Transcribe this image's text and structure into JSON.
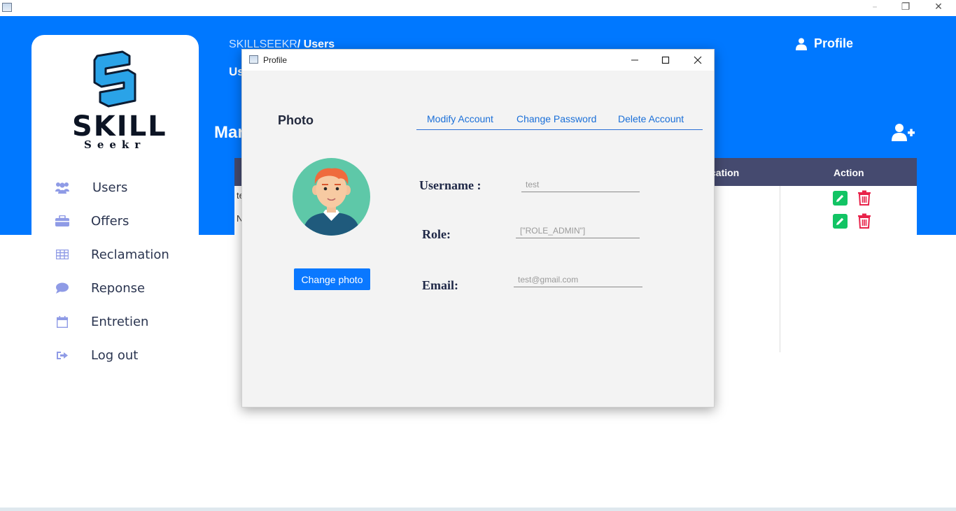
{
  "app": {
    "breadcrumb_root": "SKILLSEEKR",
    "breadcrumb_current": "/ Users",
    "subtitle_partial": "Us",
    "heading_partial": "Mar",
    "profile_label": "Profile",
    "logo_word": "SKILL",
    "logo_sub": "Seekr"
  },
  "sidebar": {
    "items": [
      {
        "label": "Users",
        "icon": "users-icon"
      },
      {
        "label": "Offers",
        "icon": "briefcase-icon"
      },
      {
        "label": "Reclamation",
        "icon": "table-icon"
      },
      {
        "label": "Reponse",
        "icon": "chat-bubble-icon"
      },
      {
        "label": "Entretien",
        "icon": "calendar-icon"
      },
      {
        "label": "Log out",
        "icon": "sign-out-icon"
      }
    ]
  },
  "table": {
    "headers": [
      "cation",
      "Action"
    ],
    "rows": [
      {
        "first_cell": "te"
      },
      {
        "first_cell": "N"
      }
    ]
  },
  "dialog": {
    "title": "Profile",
    "photo_title": "Photo",
    "tabs": [
      "Modify Account",
      "Change Password",
      "Delete Account"
    ],
    "change_photo_label": "Change photo",
    "fields": {
      "username_label": "Username :",
      "username_value": "test",
      "role_label": "Role:",
      "role_value": "[\"ROLE_ADMIN\"]",
      "email_label": "Email:",
      "email_value": "test@gmail.com"
    }
  },
  "colors": {
    "brand_blue": "#0078ff",
    "table_header": "#454a6f",
    "edit_green": "#12c464",
    "delete_red": "#e8234a"
  }
}
